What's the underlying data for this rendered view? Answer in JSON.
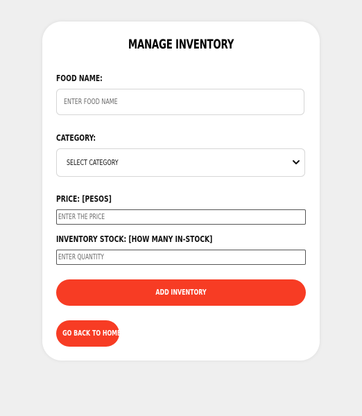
{
  "page": {
    "title": "MANAGE INVENTORY"
  },
  "form": {
    "food_name": {
      "label": "FOOD NAME:",
      "placeholder": "ENTER FOOD NAME"
    },
    "category": {
      "label": "CATEGORY:",
      "selected": "SELECT CATEGORY"
    },
    "price": {
      "label": "PRICE: [PESOS]",
      "placeholder": "ENTER THE PRICE"
    },
    "stock": {
      "label": "INVENTORY STOCK: [HOW MANY IN-STOCK]",
      "placeholder": "ENTER QUANTITY"
    }
  },
  "actions": {
    "add_label": "ADD INVENTORY",
    "back_label": "GO BACK TO HOME"
  },
  "icons": {
    "select_arrow": "chevron-down-icon"
  },
  "colors": {
    "background": "#efefef",
    "card": "#ffffff",
    "accent": "#f73c24"
  }
}
